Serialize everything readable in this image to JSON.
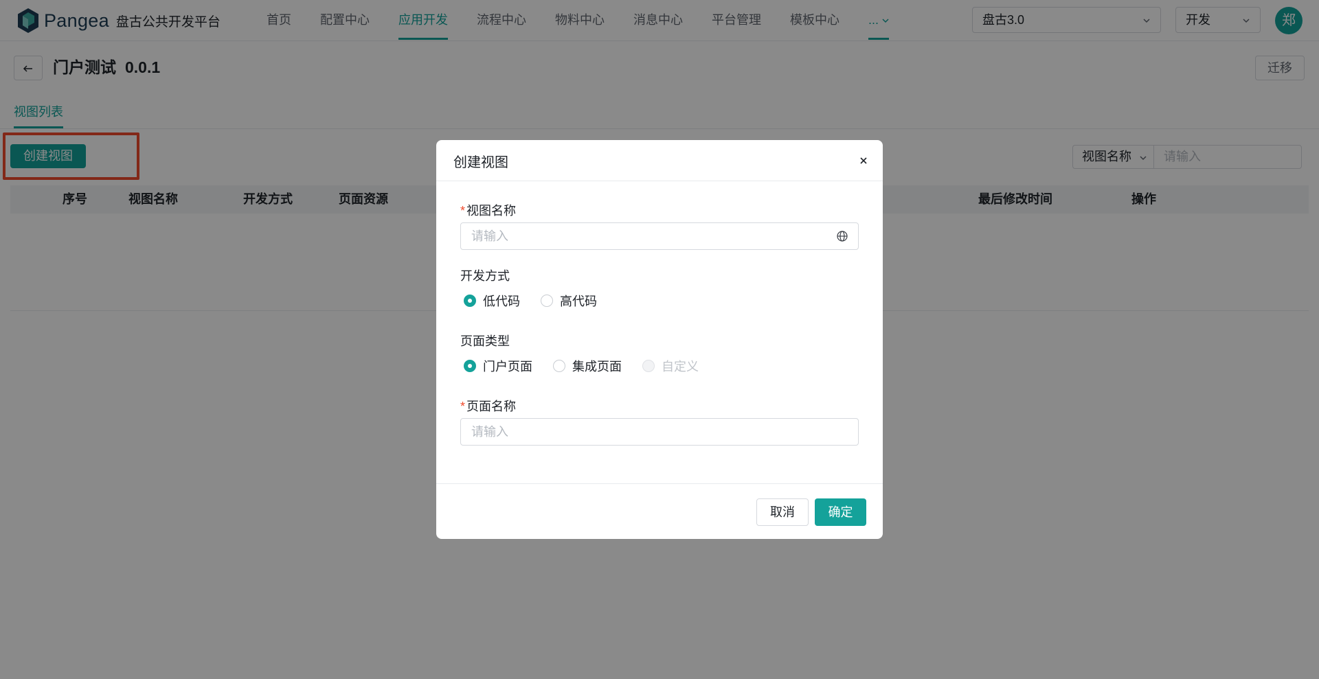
{
  "header": {
    "logo_text": "Pangea",
    "platform_name": "盘古公共开发平台",
    "nav": [
      {
        "label": "首页"
      },
      {
        "label": "配置中心"
      },
      {
        "label": "应用开发"
      },
      {
        "label": "流程中心"
      },
      {
        "label": "物料中心"
      },
      {
        "label": "消息中心"
      },
      {
        "label": "平台管理"
      },
      {
        "label": "模板中心"
      }
    ],
    "nav_more": "...",
    "active_nav": "应用开发",
    "project_select": "盘古3.0",
    "env_select": "开发",
    "avatar_text": "郑"
  },
  "page": {
    "title": "门户测试",
    "version": "0.0.1",
    "migrate_label": "迁移",
    "tab_label": "视图列表",
    "create_button": "创建视图",
    "filter_field": "视图名称",
    "filter_placeholder": "请输入",
    "table_columns": [
      "序号",
      "视图名称",
      "开发方式",
      "页面资源",
      "最后修改时间",
      "操作"
    ]
  },
  "modal": {
    "title": "创建视图",
    "view_name_label": "视图名称",
    "view_name_placeholder": "请输入",
    "dev_mode_label": "开发方式",
    "dev_mode_options": [
      {
        "label": "低代码",
        "checked": true
      },
      {
        "label": "高代码",
        "checked": false
      }
    ],
    "page_type_label": "页面类型",
    "page_type_options": [
      {
        "label": "门户页面",
        "checked": true
      },
      {
        "label": "集成页面",
        "checked": false
      },
      {
        "label": "自定义",
        "checked": false,
        "disabled": true
      }
    ],
    "page_name_label": "页面名称",
    "page_name_placeholder": "请输入",
    "cancel_label": "取消",
    "ok_label": "确定"
  },
  "colors": {
    "accent": "#14a29a",
    "highlight": "#f04b2e",
    "required": "#f04b2e"
  }
}
